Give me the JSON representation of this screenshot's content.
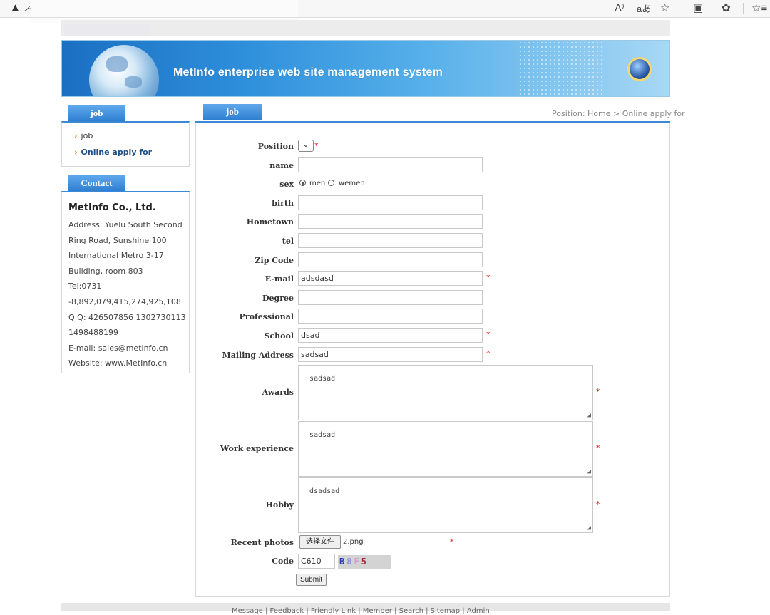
{
  "browser": {
    "warning_text": "不",
    "icons": [
      "read-aloud-icon",
      "translate-icon",
      "favorite-icon",
      "collections-icon",
      "extensions-icon",
      "favorites-bar-icon"
    ]
  },
  "banner": {
    "title": "MetInfo enterprise web site management system"
  },
  "sidebar": {
    "job_tab": "job",
    "job_items": [
      {
        "label": "job",
        "active": false
      },
      {
        "label": "Online apply for",
        "active": true
      }
    ],
    "contact_tab": "Contact",
    "company": "MetInfo Co., Ltd.",
    "contact_lines": [
      "Address: Yuelu South Second",
      "Ring Road, Sunshine 100",
      "International Metro 3-17",
      "Building, room 803",
      "Tel:0731",
      "-8,892,079,415,274,925,108",
      "Q Q: 426507856 1302730113",
      "1498488199",
      "E-mail: sales@metinfo.cn",
      "Website: www.MetInfo.cn"
    ]
  },
  "main": {
    "tab": "job",
    "breadcrumb": "Position: Home > Online apply for",
    "required_mark": "*",
    "form": {
      "position_label": "Position",
      "position_value": "⌄",
      "name_label": "name",
      "name_value": "",
      "sex_label": "sex",
      "sex_options": [
        "men",
        "wemen"
      ],
      "sex_selected": "men",
      "birth_label": "birth",
      "birth_value": "",
      "hometown_label": "Hometown",
      "hometown_value": "",
      "tel_label": "tel",
      "tel_value": "",
      "zip_label": "Zip Code",
      "zip_value": "",
      "email_label": "E-mail",
      "email_value": "adsdasd",
      "degree_label": "Degree",
      "degree_value": "",
      "professional_label": "Professional",
      "professional_value": "",
      "school_label": "School",
      "school_value": "dsad",
      "mailing_label": "Mailing Address",
      "mailing_value": "sadsad",
      "awards_label": "Awards",
      "awards_value": "sadsad",
      "work_label": "Work experience",
      "work_value": "sadsad",
      "hobby_label": "Hobby",
      "hobby_value": "dsadsad",
      "photos_label": "Recent photos",
      "file_button": "选择文件",
      "file_name": "2.png",
      "code_label": "Code",
      "code_value": "C610",
      "captcha_text": "B8F5",
      "submit": "Submit"
    }
  },
  "footer": {
    "links": "Message | Feedback | Friendly Link | Member | Search | Sitemap | Admin"
  },
  "colors": {
    "accent": "#3a89d6",
    "required": "#d81e1e",
    "active_link": "#1f4f87",
    "arrow": "#e08b1a"
  }
}
